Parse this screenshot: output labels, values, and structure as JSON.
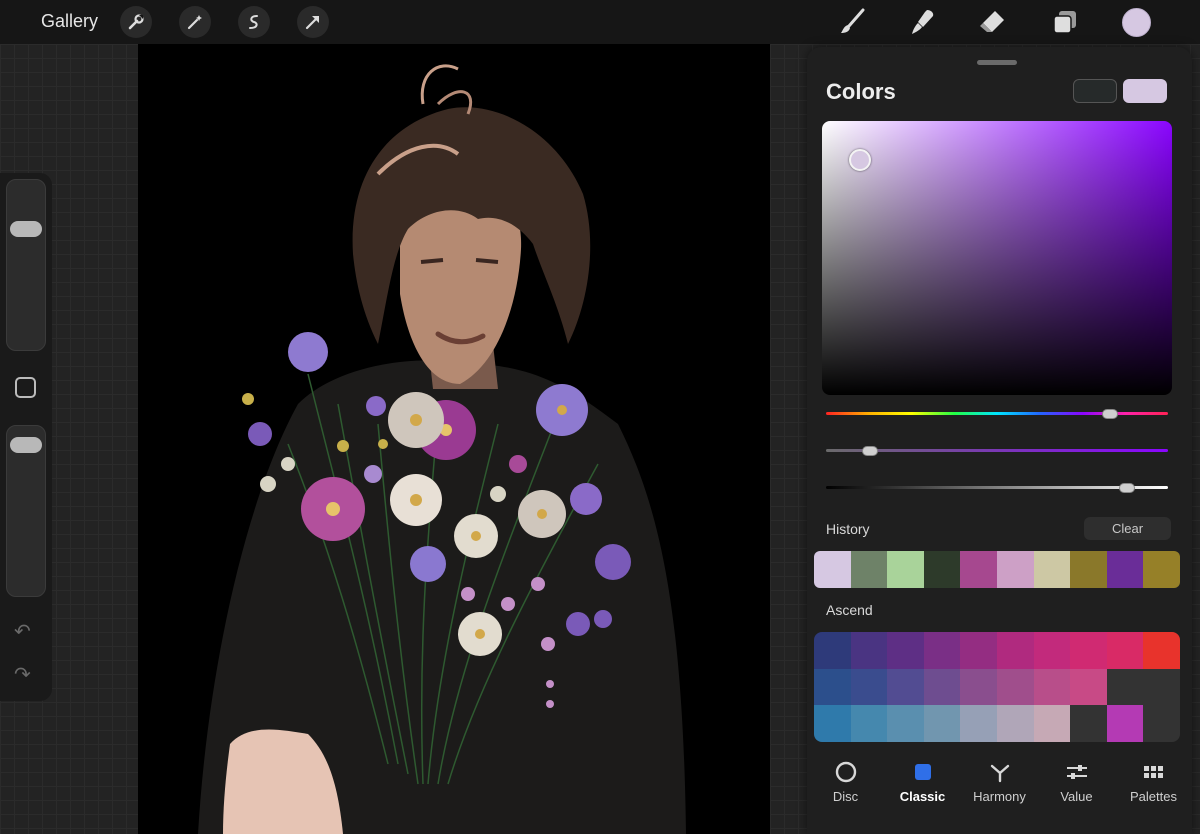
{
  "topbar": {
    "gallery_label": "Gallery",
    "actions": [
      "wrench-icon",
      "magic-wand-icon",
      "selection-icon",
      "transform-arrow-icon"
    ],
    "tools": [
      "brush-icon",
      "smudge-icon",
      "eraser-icon",
      "layers-icon"
    ],
    "current_color": "#d6c8e2"
  },
  "sidebar": {
    "brush_size_level": 0.25,
    "opacity_level": 0.05,
    "undo_icon": "undo-icon",
    "redo_icon": "redo-icon"
  },
  "colors_panel": {
    "title": "Colors",
    "secondary_color": "#262a2a",
    "primary_color": "#d6c8e2",
    "hue_level": 0.83,
    "saturation_level": 0.13,
    "brightness_level": 0.88,
    "history_label": "History",
    "clear_label": "Clear",
    "history_colors": [
      "#d6c8e2",
      "#6e8268",
      "#a9d39a",
      "#2d3a2a",
      "#a6488f",
      "#cda0c6",
      "#cdc8a4",
      "#8a782a",
      "#6a2d98",
      "#968028"
    ],
    "palette_name": "Ascend",
    "palette_colors": [
      "#2e3a7a",
      "#4a3482",
      "#5e2f85",
      "#7a2f86",
      "#942d82",
      "#b02a7f",
      "#c22a7c",
      "#d02a72",
      "#d92a66",
      "#e8332c",
      "#2c4f8c",
      "#3a4c8e",
      "#524c92",
      "#6e4d90",
      "#8a4e8e",
      "#a04e8c",
      "#b84e8a",
      "#c84a86",
      "#333333",
      "#333333",
      "#2f7aab",
      "#4588ae",
      "#5a8faf",
      "#7196af",
      "#96a0b6",
      "#b0a6b8",
      "#c6a9b5",
      "#333333",
      "#b43ab4",
      "#333333"
    ],
    "tabs": [
      {
        "label": "Disc",
        "icon": "disc-icon"
      },
      {
        "label": "Classic",
        "icon": "classic-square-icon"
      },
      {
        "label": "Harmony",
        "icon": "harmony-icon"
      },
      {
        "label": "Value",
        "icon": "sliders-icon"
      },
      {
        "label": "Palettes",
        "icon": "palettes-grid-icon"
      }
    ],
    "active_tab": "Classic"
  }
}
